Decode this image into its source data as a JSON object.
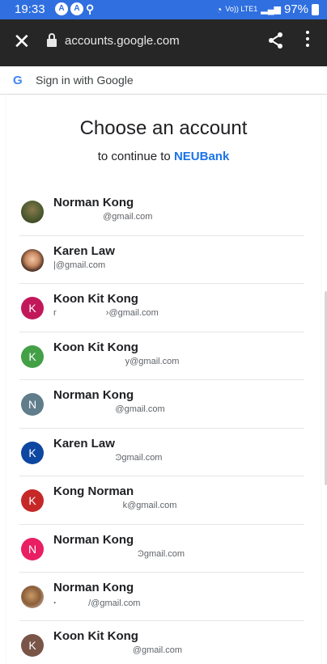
{
  "status_bar": {
    "time": "19:33",
    "network_label": "Vo)) LTE1",
    "battery_percent": "97%"
  },
  "browser": {
    "close_icon": "close-icon",
    "url": "accounts.google.com",
    "share_icon": "share-icon",
    "more_icon": "more-vert-icon"
  },
  "sign_in_strip": {
    "logo_letter": "G",
    "label": "Sign in with Google"
  },
  "page": {
    "heading": "Choose an account",
    "subheading_prefix": "to continue to",
    "brand": "NEUBank"
  },
  "accounts": [
    {
      "name": "Norman Kong",
      "email": "                    @gmail.com",
      "initial": "",
      "color": "#4e5a2f",
      "photo": "photo1"
    },
    {
      "name": "Karen Law",
      "email": "|@gmail.com",
      "initial": "",
      "color": "#c98a63",
      "photo": "photo2"
    },
    {
      "name": "Koon Kit Kong",
      "email": "r                    ›@gmail.com",
      "initial": "K",
      "color": "#c2185b",
      "photo": ""
    },
    {
      "name": "Koon Kit Kong",
      "email": "                             y@gmail.com",
      "initial": "K",
      "color": "#43a047",
      "photo": ""
    },
    {
      "name": "Norman Kong",
      "email": "                         @gmail.com",
      "initial": "N",
      "color": "#607d8b",
      "photo": ""
    },
    {
      "name": "Karen Law",
      "email": "                         Ͽgmail.com",
      "initial": "K",
      "color": "#0d47a1",
      "photo": ""
    },
    {
      "name": "Kong Norman",
      "email": "                            k@gmail.com",
      "initial": "K",
      "color": "#c62828",
      "photo": ""
    },
    {
      "name": "Norman Kong",
      "email": "                                  Ͽgmail.com",
      "initial": "N",
      "color": "#e91e63",
      "photo": ""
    },
    {
      "name": "Norman Kong",
      "email": "ꞏ             /@gmail.com",
      "initial": "",
      "color": "#8b5e3a",
      "photo": "photo3"
    },
    {
      "name": "Koon Kit Kong",
      "email": "                                @gmail.com",
      "initial": "K",
      "color": "#795548",
      "photo": ""
    }
  ],
  "colors": {
    "status_bar_bg": "#2f6fe0",
    "toolbar_bg": "#262626",
    "brand_link": "#1a73e8"
  }
}
